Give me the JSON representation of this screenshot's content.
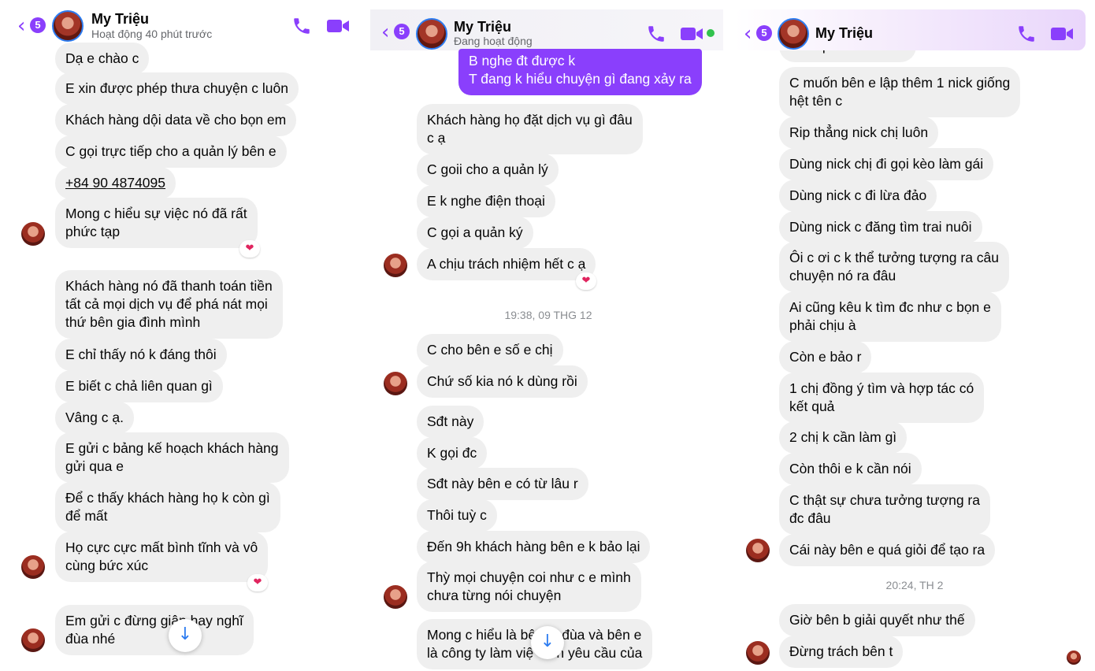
{
  "accent_color": "#8a3ffc",
  "back_badge": "5",
  "panel1": {
    "contact_name": "My Triệu",
    "status": "Hoạt động 40 phút trước",
    "messages": [
      "Dạ e chào c",
      "E xin được phép thưa chuyện c luôn",
      "Khách hàng dội data về cho bọn em",
      "C gọi trực tiếp cho a quản lý bên e",
      "+84 90 4874095",
      "Mong c hiểu sự việc nó đã rất\nphức tạp",
      "Khách hàng nó đã thanh toán tiền\ntất cả mọi dịch vụ để phá nát mọi\nthứ bên gia đình mình",
      "E chỉ thấy nó k đáng thôi",
      "E biết c chả liên quan gì",
      "Vâng c ạ.",
      "E gửi c bảng kế hoạch khách hàng\ngửi qua e",
      "Để c thấy khách hàng họ k còn gì\nđể mất",
      "Họ cực cực mất bình tĩnh và vô\ncùng bức xúc",
      "Em gửi c đừng giận hay nghĩ\nđùa nhé"
    ],
    "reaction": "❤"
  },
  "panel2": {
    "contact_name": "My Triệu",
    "status": "Đang hoạt động",
    "sent_message": "B nghe đt được k\nT đang k hiểu chuyện gì đang xảy ra",
    "messages_a": [
      "Khách hàng họ đặt dịch vụ gì đâu\nc ạ",
      "C goii cho a quản lý",
      "E k nghe điện thoại",
      "C gọi a quản ký",
      "A chịu trách nhiệm hết c ạ"
    ],
    "timestamp": "19:38, 09 THG 12",
    "messages_b": [
      "C cho bên e số e chị",
      "Chứ số kia nó k dùng rồi",
      "Sđt này",
      "K gọi đc",
      "Sđt này bên e có từ lâu r",
      "Thôi tuỳ c",
      "Đến 9h khách hàng bên e k bảo lại",
      "Thỳ mọi chuyện coi như c e mình\nchưa từng nói chuyện",
      "Mong c hiểu là bê    k đùa và bên e\nlà công ty làm việ    en yêu cầu của"
    ]
  },
  "panel3": {
    "contact_name": "My Triệu",
    "messages_a": [
      "Ôi c quá trẻ còn ào",
      "C muốn bên e lập thêm 1 nick giống\nhệt tên c",
      "Rip thẳng nick chị luôn",
      "Dùng nick chị đi gọi kèo làm gái",
      "Dùng nick c đi lừa đảo",
      "Dùng nick c đăng tìm trai nuôi",
      "Ôi c ơi c k thể tưởng tượng ra câu\nchuyện nó ra đâu",
      "Ai cũng kêu k tìm đc như c bọn e\nphải chịu à",
      "Còn e bảo r",
      "1 chị đồng ý tìm và hợp tác có\nkết quả",
      "2 chị k cần làm gì",
      "Còn thôi e k cần nói",
      "C thật sự chưa tưởng tượng ra\nđc đâu",
      "Cái này bên e quá giỏi để tạo ra"
    ],
    "timestamp": "20:24, TH 2",
    "messages_b": [
      "Giờ bên b giải quyết như thế",
      "Đừng trách bên t"
    ]
  }
}
